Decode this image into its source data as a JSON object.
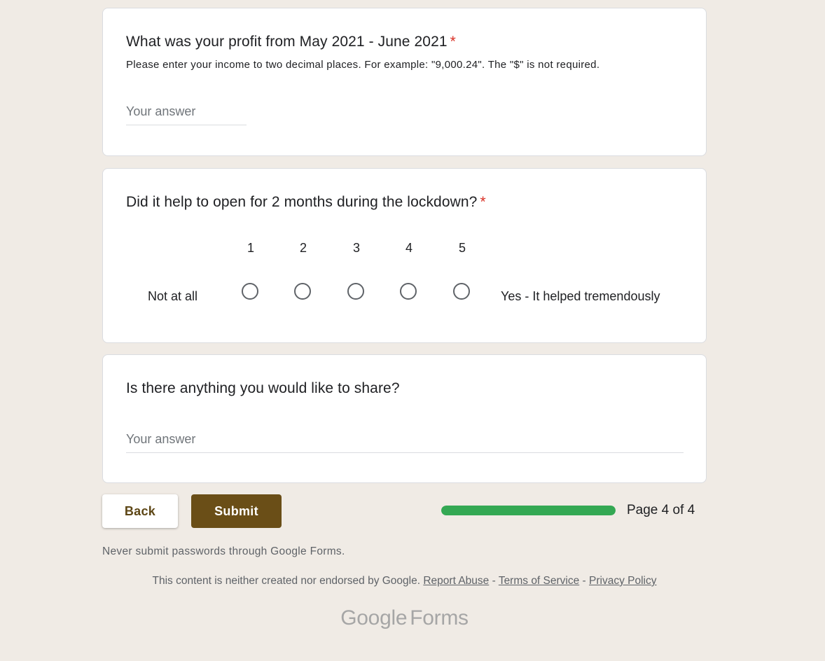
{
  "questions": {
    "profit": {
      "title": "What was your profit from May 2021 - June 2021",
      "required_mark": "*",
      "description": "Please enter your income to two decimal places. For example: \"9,000.24\". The \"$\" is not required.",
      "placeholder": "Your answer",
      "value": ""
    },
    "lockdown": {
      "title": "Did it help to open for 2 months during the lockdown?",
      "required_mark": "*",
      "scale": [
        "1",
        "2",
        "3",
        "4",
        "5"
      ],
      "low_label": "Not at all",
      "high_label": "Yes - It helped tremendously",
      "selected": null
    },
    "share": {
      "title": "Is there anything you would like to share?",
      "placeholder": "Your answer",
      "value": ""
    }
  },
  "nav": {
    "back_label": "Back",
    "submit_label": "Submit",
    "progress": 1.0,
    "page_text": "Page 4 of 4"
  },
  "footer": {
    "password_warning": "Never submit passwords through Google Forms.",
    "disclaimer": "This content is neither created nor endorsed by Google.",
    "report_abuse": "Report Abuse",
    "separator": "-",
    "terms": "Terms of Service",
    "privacy": "Privacy Policy",
    "brand_google": "Google",
    "brand_forms": "Forms"
  },
  "colors": {
    "background": "#f0ebe5",
    "accent": "#6a4e17",
    "progress": "#34a853",
    "required": "#d93025"
  }
}
